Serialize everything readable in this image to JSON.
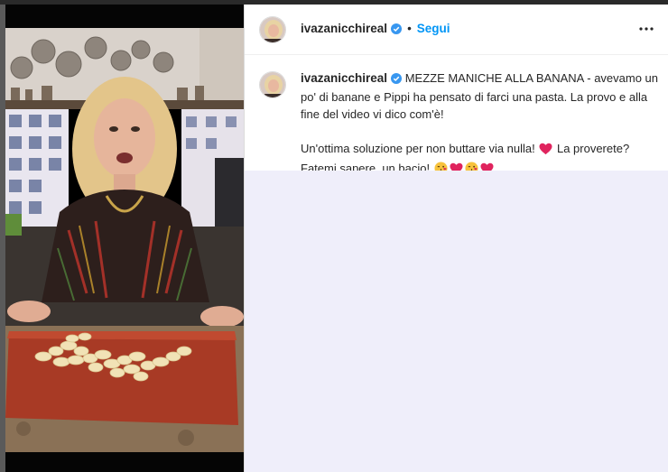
{
  "post": {
    "username": "ivazanicchireal",
    "header_separator": "•",
    "follow_label": "Segui",
    "more_icon": "more-horizontal-icon",
    "verified_icon": "verified-badge-icon",
    "caption": {
      "title": "MEZZE MANICHE ALLA BANANA",
      "line1": " - avevamo un po' di banane e Pippi ha pensato di farci una pasta. La provo e alla fine del video vi dico com'è!",
      "line2a": "Un'ottima soluzione per non buttare via nulla! ",
      "line2b": " La proverete? Fatemi sapere, un bacio! "
    }
  },
  "media": {
    "type": "video",
    "description_icon": "video-frame"
  },
  "colors": {
    "accent": "#0095f6",
    "comments_bg": "#efeefa",
    "heart": "#ed4956"
  }
}
